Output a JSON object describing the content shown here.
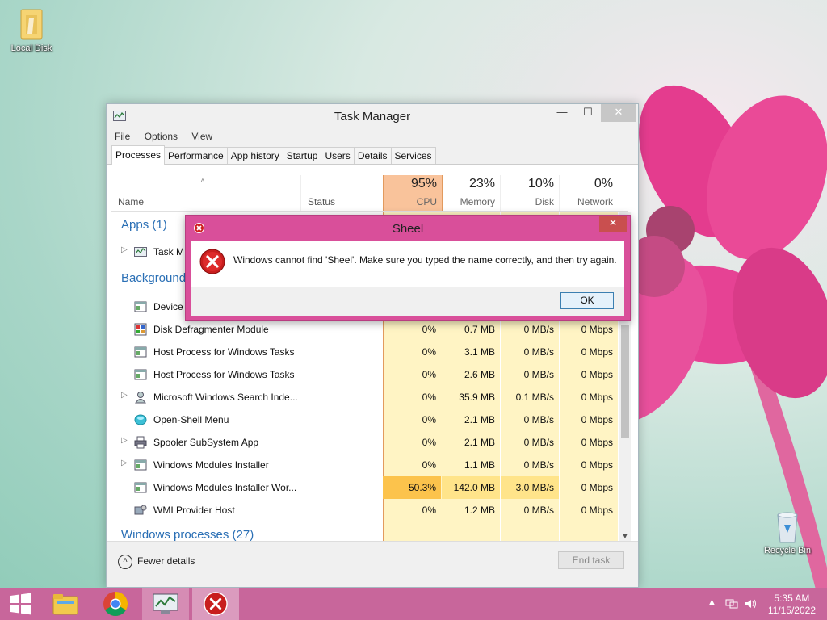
{
  "desktop": {
    "icons": [
      {
        "label": "Local Disk"
      },
      {
        "label": "Recycle Bin"
      }
    ]
  },
  "task_manager": {
    "title": "Task Manager",
    "menu": [
      "File",
      "Options",
      "View"
    ],
    "tabs": [
      "Processes",
      "Performance",
      "App history",
      "Startup",
      "Users",
      "Details",
      "Services"
    ],
    "active_tab": "Processes",
    "columns": {
      "name": "Name",
      "status": "Status",
      "cpu": {
        "pct": "95%",
        "label": "CPU"
      },
      "memory": {
        "pct": "23%",
        "label": "Memory"
      },
      "disk": {
        "pct": "10%",
        "label": "Disk"
      },
      "network": {
        "pct": "0%",
        "label": "Network"
      }
    },
    "groups": {
      "apps": "Apps (1)",
      "background": "Background",
      "windows": "Windows processes (27)"
    },
    "app_rows": [
      {
        "name": "Task M",
        "icon": "task-manager-icon",
        "expandable": true
      }
    ],
    "background_rows": [
      {
        "name": "Device",
        "icon": "service-icon",
        "expandable": false,
        "cpu": "",
        "memory": "",
        "disk": "",
        "network": ""
      },
      {
        "name": "Disk Defragmenter Module",
        "icon": "defrag-icon",
        "expandable": false,
        "cpu": "0%",
        "memory": "0.7 MB",
        "disk": "0 MB/s",
        "network": "0 Mbps"
      },
      {
        "name": "Host Process for Windows Tasks",
        "icon": "service-icon",
        "expandable": false,
        "cpu": "0%",
        "memory": "3.1 MB",
        "disk": "0 MB/s",
        "network": "0 Mbps"
      },
      {
        "name": "Host Process for Windows Tasks",
        "icon": "service-icon",
        "expandable": false,
        "cpu": "0%",
        "memory": "2.6 MB",
        "disk": "0 MB/s",
        "network": "0 Mbps"
      },
      {
        "name": "Microsoft Windows Search Inde...",
        "icon": "search-user-icon",
        "expandable": true,
        "cpu": "0%",
        "memory": "35.9 MB",
        "disk": "0.1 MB/s",
        "network": "0 Mbps"
      },
      {
        "name": "Open-Shell Menu",
        "icon": "shell-icon",
        "expandable": false,
        "cpu": "0%",
        "memory": "2.1 MB",
        "disk": "0 MB/s",
        "network": "0 Mbps"
      },
      {
        "name": "Spooler SubSystem App",
        "icon": "printer-icon",
        "expandable": true,
        "cpu": "0%",
        "memory": "2.1 MB",
        "disk": "0 MB/s",
        "network": "0 Mbps"
      },
      {
        "name": "Windows Modules Installer",
        "icon": "service-icon",
        "expandable": true,
        "cpu": "0%",
        "memory": "1.1 MB",
        "disk": "0 MB/s",
        "network": "0 Mbps"
      },
      {
        "name": "Windows Modules Installer Wor...",
        "icon": "service-icon",
        "expandable": false,
        "cpu": "50.3%",
        "memory": "142.0 MB",
        "disk": "3.0 MB/s",
        "network": "0 Mbps",
        "highlight": true
      },
      {
        "name": "WMI Provider Host",
        "icon": "wmi-icon",
        "expandable": false,
        "cpu": "0%",
        "memory": "1.2 MB",
        "disk": "0 MB/s",
        "network": "0 Mbps"
      }
    ],
    "footer": {
      "fewer_details": "Fewer details",
      "end_task": "End task"
    }
  },
  "error_dialog": {
    "title": "Sheel",
    "message": "Windows cannot find 'Sheel'. Make sure you typed the name correctly, and then try again.",
    "ok_label": "OK",
    "close_label": "✕"
  },
  "taskbar": {
    "time": "5:35 AM",
    "date": "11/15/2022"
  },
  "colors": {
    "accent_pink": "#d94f9a",
    "taskbar": "#c8669b",
    "cpu_header_hot": "#f9c39b",
    "heat_light": "#fff4c4",
    "heat_high": "#fcc34c"
  }
}
